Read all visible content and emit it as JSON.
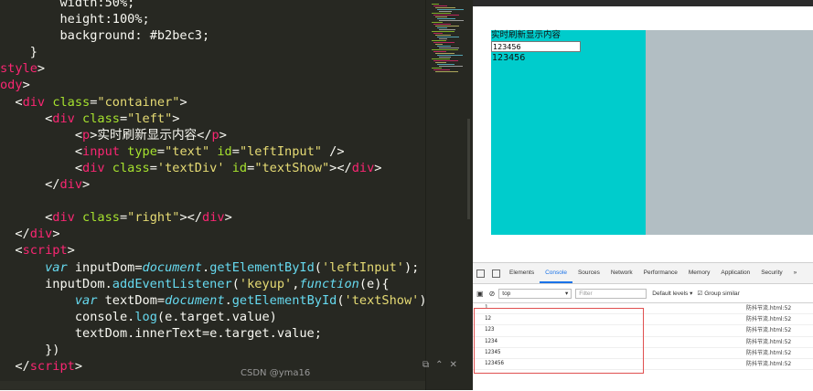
{
  "editor": {
    "lines": [
      [
        [
          "pl",
          "        width:50%;"
        ]
      ],
      [
        [
          "pl",
          "        height:100%;"
        ]
      ],
      [
        [
          "pl",
          "        background: "
        ],
        [
          "pl",
          "#b2bec3"
        ],
        [
          "pl",
          ";"
        ]
      ],
      [
        [
          "pl",
          "    }"
        ]
      ],
      [
        [
          "tg",
          "style"
        ],
        [
          "pl",
          ">"
        ]
      ],
      [
        [
          "tg",
          "ody"
        ],
        [
          "pl",
          ">"
        ]
      ],
      [
        [
          "pl",
          "  <"
        ],
        [
          "tg",
          "div"
        ],
        [
          "pl",
          " "
        ],
        [
          "at",
          "class"
        ],
        [
          "pl",
          "="
        ],
        [
          "st",
          "\"container\""
        ],
        [
          "pl",
          ">"
        ]
      ],
      [
        [
          "pl",
          "      <"
        ],
        [
          "tg",
          "div"
        ],
        [
          "pl",
          " "
        ],
        [
          "at",
          "class"
        ],
        [
          "pl",
          "="
        ],
        [
          "st",
          "\"left\""
        ],
        [
          "pl",
          ">"
        ]
      ],
      [
        [
          "pl",
          "          <"
        ],
        [
          "tg",
          "p"
        ],
        [
          "pl",
          ">实时刷新显示内容</"
        ],
        [
          "tg",
          "p"
        ],
        [
          "pl",
          ">"
        ]
      ],
      [
        [
          "pl",
          "          <"
        ],
        [
          "tg",
          "input"
        ],
        [
          "pl",
          " "
        ],
        [
          "at",
          "type"
        ],
        [
          "pl",
          "="
        ],
        [
          "st",
          "\"text\""
        ],
        [
          "pl",
          " "
        ],
        [
          "at",
          "id"
        ],
        [
          "pl",
          "="
        ],
        [
          "st",
          "\"leftInput\""
        ],
        [
          "pl",
          " />"
        ]
      ],
      [
        [
          "pl",
          "          <"
        ],
        [
          "tg",
          "div"
        ],
        [
          "pl",
          " "
        ],
        [
          "at",
          "class"
        ],
        [
          "pl",
          "="
        ],
        [
          "st",
          "'textDiv'"
        ],
        [
          "pl",
          " "
        ],
        [
          "at",
          "id"
        ],
        [
          "pl",
          "="
        ],
        [
          "st",
          "\"textShow\""
        ],
        [
          "pl",
          "></"
        ],
        [
          "tg",
          "div"
        ],
        [
          "pl",
          ">"
        ]
      ],
      [
        [
          "pl",
          "      </"
        ],
        [
          "tg",
          "div"
        ],
        [
          "pl",
          ">"
        ]
      ],
      [
        [
          "pl",
          ""
        ]
      ],
      [
        [
          "pl",
          "      <"
        ],
        [
          "tg",
          "div"
        ],
        [
          "pl",
          " "
        ],
        [
          "at",
          "class"
        ],
        [
          "pl",
          "="
        ],
        [
          "st",
          "\"right\""
        ],
        [
          "pl",
          "></"
        ],
        [
          "tg",
          "div"
        ],
        [
          "pl",
          ">"
        ]
      ],
      [
        [
          "pl",
          "  </"
        ],
        [
          "tg",
          "div"
        ],
        [
          "pl",
          ">"
        ]
      ],
      [
        [
          "pl",
          "  <"
        ],
        [
          "tg",
          "script"
        ],
        [
          "pl",
          ">"
        ]
      ],
      [
        [
          "pl",
          "      "
        ],
        [
          "kw",
          "var"
        ],
        [
          "pl",
          " inputDom="
        ],
        [
          "kw",
          "document"
        ],
        [
          "pl",
          "."
        ],
        [
          "fn",
          "getElementById"
        ],
        [
          "pl",
          "("
        ],
        [
          "st",
          "'leftInput'"
        ],
        [
          "pl",
          ");"
        ]
      ],
      [
        [
          "pl",
          "      inputDom."
        ],
        [
          "fn",
          "addEventListener"
        ],
        [
          "pl",
          "("
        ],
        [
          "st",
          "'keyup'"
        ],
        [
          "pl",
          ","
        ],
        [
          "kw",
          "function"
        ],
        [
          "pl",
          "(e){"
        ]
      ],
      [
        [
          "pl",
          "          "
        ],
        [
          "kw",
          "var"
        ],
        [
          "pl",
          " textDom="
        ],
        [
          "kw",
          "document"
        ],
        [
          "pl",
          "."
        ],
        [
          "fn",
          "getElementById"
        ],
        [
          "pl",
          "("
        ],
        [
          "st",
          "'textShow'"
        ],
        [
          "pl",
          ");"
        ]
      ],
      [
        [
          "pl",
          "          console."
        ],
        [
          "fn",
          "log"
        ],
        [
          "pl",
          "(e.target.value)"
        ]
      ],
      [
        [
          "pl",
          "          textDom.innerText=e.target.value;"
        ]
      ],
      [
        [
          "pl",
          "      })"
        ]
      ],
      [
        [
          "pl",
          "  </"
        ],
        [
          "tg",
          "script"
        ],
        [
          "pl",
          ">"
        ]
      ]
    ]
  },
  "preview": {
    "left_color": "#00cccc",
    "right_color": "#b2bec3",
    "heading": "实时刷新显示内容",
    "input_value": "123456",
    "text_show": "123456"
  },
  "devtools": {
    "tabs": [
      "Elements",
      "Console",
      "Sources",
      "Network",
      "Performance",
      "Memory",
      "Application",
      "Security",
      "»"
    ],
    "active_tab": "Console",
    "context": "top",
    "filter_placeholder": "Filter",
    "levels": "Default levels ▾",
    "group_similar": "Group similar",
    "logs": [
      "1",
      "12",
      "123",
      "1234",
      "12345",
      "123456"
    ],
    "log_source": "防抖节流.html:52"
  },
  "watermark": "CSDN @yma16"
}
